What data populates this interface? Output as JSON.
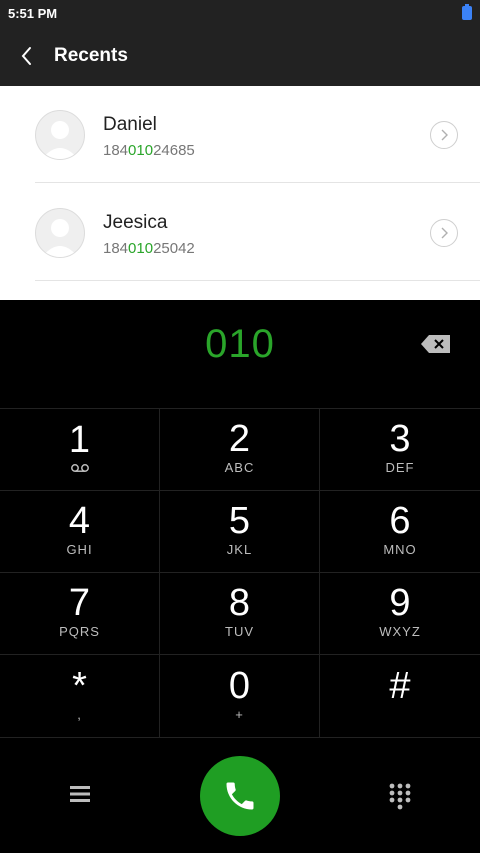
{
  "status_bar": {
    "time": "5:51 PM"
  },
  "app_bar": {
    "title": "Recents"
  },
  "recents": [
    {
      "name": "Daniel",
      "number_prefix": "184",
      "number_match": "010",
      "number_suffix": "24685"
    },
    {
      "name": "Jeesica",
      "number_prefix": "184",
      "number_match": "010",
      "number_suffix": "25042"
    }
  ],
  "dialer": {
    "input": "010",
    "keys": [
      {
        "digit": "1",
        "letters": ""
      },
      {
        "digit": "2",
        "letters": "ABC"
      },
      {
        "digit": "3",
        "letters": "DEF"
      },
      {
        "digit": "4",
        "letters": "GHI"
      },
      {
        "digit": "5",
        "letters": "JKL"
      },
      {
        "digit": "6",
        "letters": "MNO"
      },
      {
        "digit": "7",
        "letters": "PQRS"
      },
      {
        "digit": "8",
        "letters": "TUV"
      },
      {
        "digit": "9",
        "letters": "WXYZ"
      },
      {
        "digit": "*",
        "letters": ","
      },
      {
        "digit": "0",
        "letters": "+"
      },
      {
        "digit": "#",
        "letters": ""
      }
    ]
  },
  "colors": {
    "accent": "#2aa52a",
    "call_button": "#1f9e23",
    "header": "#222222"
  },
  "icons": {
    "back": "chevron-left-icon",
    "backspace": "backspace-icon",
    "menu": "menu-icon",
    "call": "phone-icon",
    "dialpad": "dialpad-icon",
    "voicemail": "voicemail-icon"
  }
}
